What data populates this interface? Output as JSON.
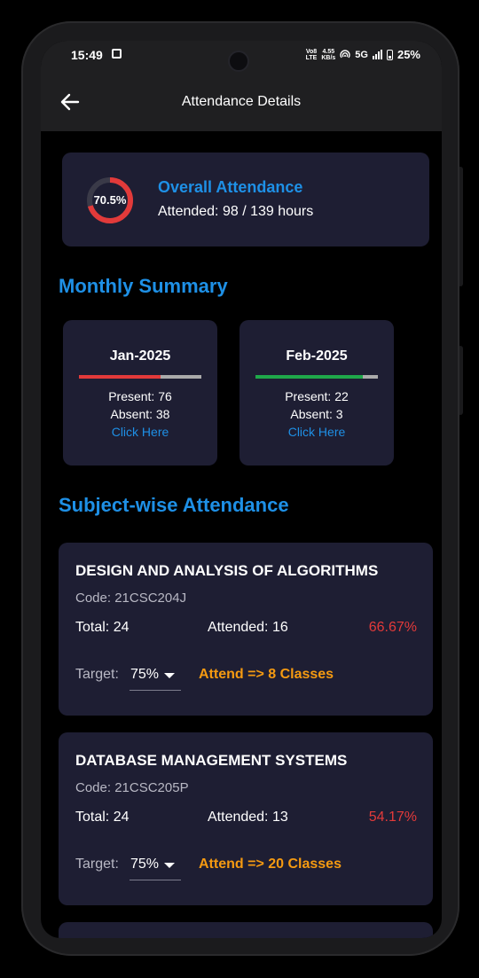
{
  "status_bar": {
    "time": "15:49",
    "network_top": "Vo8",
    "network_bottom": "LTE",
    "speed_value": "4.55",
    "speed_unit": "KB/s",
    "signal_type": "5G",
    "battery": "25%"
  },
  "app_bar": {
    "title": "Attendance Details",
    "back_icon": "back-arrow-icon"
  },
  "overall": {
    "percent_label": "70.5%",
    "percent_value": 70.5,
    "title": "Overall Attendance",
    "attended_text": "Attended: 98 / 139 hours"
  },
  "monthly_summary": {
    "title": "Monthly Summary",
    "months": [
      {
        "name": "Jan-2025",
        "present": "Present: 76",
        "absent": "Absent: 38",
        "link": "Click Here",
        "present_fraction": 0.667,
        "bar_color": "#e23a3a"
      },
      {
        "name": "Feb-2025",
        "present": "Present: 22",
        "absent": "Absent: 3",
        "link": "Click Here",
        "present_fraction": 0.88,
        "bar_color": "#1fa84a"
      }
    ]
  },
  "subjects_section": {
    "title": "Subject-wise Attendance",
    "subjects": [
      {
        "name": "DESIGN AND ANALYSIS OF ALGORITHMS",
        "code": "Code: 21CSC204J",
        "total": "Total: 24",
        "attended": "Attended: 16",
        "percent": "66.67%",
        "target_label": "Target:",
        "target_value": "75%",
        "advice": "Attend => 8 Classes"
      },
      {
        "name": "DATABASE MANAGEMENT SYSTEMS",
        "code": "Code: 21CSC205P",
        "total": "Total: 24",
        "attended": "Attended: 13",
        "percent": "54.17%",
        "target_label": "Target:",
        "target_value": "75%",
        "advice": "Attend => 20 Classes"
      }
    ]
  },
  "colors": {
    "accent": "#1e90e6",
    "card": "#1e1e33",
    "danger": "#e23a3a",
    "warning": "#f59a11",
    "success": "#1fa84a"
  }
}
